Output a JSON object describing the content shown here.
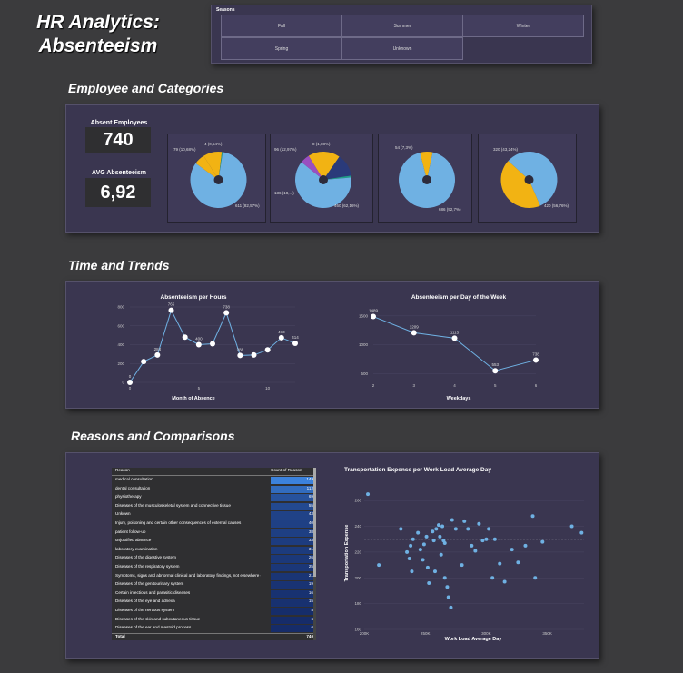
{
  "dashboard_title": "HR Analytics: Absenteeism",
  "title_line1": "HR Analytics:",
  "title_line2": "Absenteeism",
  "seasons": {
    "title": "Seasons",
    "options": [
      "Fall",
      "Summer",
      "Winter",
      "Spring",
      "Unknown"
    ]
  },
  "sections": {
    "employee": "Employee and Categories",
    "time": "Time and Trends",
    "reasons": "Reasons and Comparisons"
  },
  "kpis": {
    "absent_label": "Absent Employees",
    "absent_value": "740",
    "avg_label": "AVG Absenteeism",
    "avg_value": "6,92"
  },
  "pies": [
    {
      "labels": [
        "79 (10,68%)",
        "4 (0,54%)",
        "611 (82,57%)"
      ],
      "slices": [
        10.68,
        0.54,
        82.57,
        6.21
      ],
      "colors": [
        "#f2b313",
        "#1ea08a",
        "#6fb1e3",
        "#f2b313"
      ]
    },
    {
      "labels": [
        "96 (12,97%)",
        "8 (1,08%)",
        "136 (18,...)",
        "460 (62,16%)"
      ],
      "slices": [
        18.38,
        12.97,
        1.08,
        62.16,
        5.41
      ],
      "colors": [
        "#f2b313",
        "#2a3a7a",
        "#1ea08a",
        "#6fb1e3",
        "#9a4fc0"
      ]
    },
    {
      "labels": [
        "54 (7,3%)",
        "686 (92,7%)"
      ],
      "slices": [
        7.3,
        92.7
      ],
      "colors": [
        "#f2b313",
        "#6fb1e3"
      ]
    },
    {
      "labels": [
        "320 (43,24%)",
        "420 (56,76%)"
      ],
      "slices": [
        43.24,
        56.76
      ],
      "colors": [
        "#f2b313",
        "#6fb1e3"
      ]
    }
  ],
  "chart_data": [
    {
      "type": "line",
      "title": "Absenteeism per Hours",
      "xlabel": "Month of Absence",
      "ylabel": "",
      "x": [
        0,
        1,
        2,
        3,
        4,
        5,
        6,
        7,
        8,
        9,
        10,
        11,
        12
      ],
      "values": [
        0,
        220,
        290,
        765,
        480,
        400,
        410,
        738,
        285,
        290,
        345,
        473,
        414
      ],
      "data_labels": [
        "0",
        "",
        "284",
        "765",
        "",
        "400",
        "",
        "738",
        "288",
        "",
        "",
        "473",
        "414"
      ],
      "xticks": [
        "0",
        "5",
        "10"
      ],
      "yticks": [
        "0",
        "200",
        "400",
        "600",
        "800"
      ],
      "ylim": [
        0,
        800
      ],
      "color": "#6fb1e3"
    },
    {
      "type": "line",
      "title": "Absenteeism per Day of the Week",
      "xlabel": "Weekdays",
      "ylabel": "",
      "x": [
        2,
        3,
        4,
        5,
        6
      ],
      "values": [
        1489,
        1209,
        1115,
        553,
        738
      ],
      "data_labels": [
        "1489",
        "1209",
        "1115",
        "553",
        "738"
      ],
      "xticks": [
        "2",
        "3",
        "4",
        "5",
        "6"
      ],
      "yticks": [
        "500",
        "1000",
        "1500"
      ],
      "ylim": [
        400,
        1560
      ],
      "color": "#6fb1e3"
    },
    {
      "type": "scatter",
      "title": "Transportation Expense per Work Load Average Day",
      "xlabel": "Work Load Average Day",
      "ylabel": "Transportation Expense",
      "xticks": [
        "200K",
        "250K",
        "300K",
        "350K"
      ],
      "yticks": [
        "160",
        "180",
        "200",
        "220",
        "240",
        "260"
      ],
      "xlim": [
        200,
        380
      ],
      "ylim": [
        160,
        270
      ],
      "trend_y": 230,
      "points": [
        [
          203,
          265
        ],
        [
          212,
          210
        ],
        [
          230,
          238
        ],
        [
          235,
          220
        ],
        [
          237,
          215
        ],
        [
          238,
          225
        ],
        [
          240,
          230
        ],
        [
          239,
          205
        ],
        [
          244,
          235
        ],
        [
          246,
          222
        ],
        [
          248,
          214
        ],
        [
          249,
          226
        ],
        [
          251,
          232
        ],
        [
          253,
          196
        ],
        [
          252,
          208
        ],
        [
          256,
          236
        ],
        [
          257,
          229
        ],
        [
          258,
          205
        ],
        [
          259,
          238
        ],
        [
          261,
          241
        ],
        [
          262,
          232
        ],
        [
          263,
          218
        ],
        [
          264,
          240
        ],
        [
          265,
          229
        ],
        [
          266,
          227
        ],
        [
          266,
          200
        ],
        [
          268,
          193
        ],
        [
          269,
          185
        ],
        [
          271,
          177
        ],
        [
          272,
          245
        ],
        [
          275,
          238
        ],
        [
          280,
          210
        ],
        [
          282,
          244
        ],
        [
          285,
          238
        ],
        [
          288,
          225
        ],
        [
          291,
          221
        ],
        [
          294,
          242
        ],
        [
          297,
          229
        ],
        [
          300,
          230
        ],
        [
          302,
          238
        ],
        [
          305,
          200
        ],
        [
          307,
          230
        ],
        [
          311,
          211
        ],
        [
          315,
          197
        ],
        [
          321,
          222
        ],
        [
          326,
          212
        ],
        [
          332,
          225
        ],
        [
          338,
          248
        ],
        [
          340,
          200
        ],
        [
          346,
          228
        ],
        [
          370,
          240
        ],
        [
          378,
          235
        ]
      ],
      "color": "#6fb1e3"
    }
  ],
  "reasons_table": {
    "headers": [
      "Reason",
      "Count of Reason"
    ],
    "rows": [
      [
        "medical consultation",
        "149"
      ],
      [
        "dental consultation",
        "112"
      ],
      [
        "physiotherapy",
        "69"
      ],
      [
        "Diseases of the musculoskeletal system and connective tissue",
        "55"
      ],
      [
        "Unkown",
        "43"
      ],
      [
        "Injury, poisoning and certain other consequences of external causes",
        "40"
      ],
      [
        "patient follow-up",
        "38"
      ],
      [
        "unjustified absence",
        "33"
      ],
      [
        "laboratory examination",
        "31"
      ],
      [
        "Diseases of the digestive system",
        "26"
      ],
      [
        "Diseases of the respiratory system",
        "25"
      ],
      [
        "Symptoms, signs and abnormal clinical and laboratory findings, not elsewhere classified",
        "21"
      ],
      [
        "Diseases of the genitourinary system",
        "19"
      ],
      [
        "Certain infectious and parasitic diseases",
        "16"
      ],
      [
        "Diseases of the eye and adnexa",
        "15"
      ],
      [
        "Diseases of the nervous system",
        "8"
      ],
      [
        "Diseases of the skin and subcutaneous tissue",
        "6"
      ],
      [
        "Diseases of the ear and mastoid process",
        "6"
      ]
    ],
    "total_label": "Total",
    "total_value": "740"
  }
}
